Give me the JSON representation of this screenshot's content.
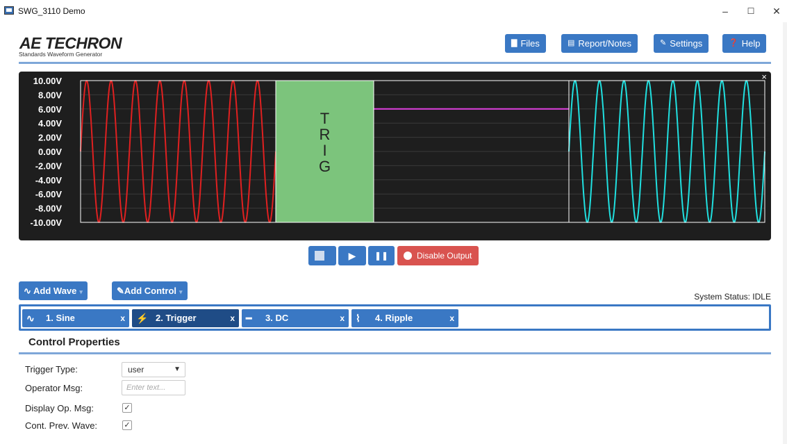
{
  "window": {
    "title": "SWG_3110 Demo",
    "minimize": "–",
    "maximize": "☐",
    "close": "✕"
  },
  "header": {
    "logo": "AE TECHRON",
    "subtitle": "Standards Waveform Generator",
    "buttons": [
      {
        "label": "Files",
        "icon": "folder-icon",
        "glyph": "▇"
      },
      {
        "label": "Report/Notes",
        "icon": "clipboard-icon",
        "glyph": "▤"
      },
      {
        "label": "Settings",
        "icon": "wrench-icon",
        "glyph": "✎"
      },
      {
        "label": "Help",
        "icon": "question-icon",
        "glyph": "❓"
      }
    ]
  },
  "scope": {
    "y_labels": [
      "10.00V",
      "8.00V",
      "6.00V",
      "4.00V",
      "2.00V",
      "0.00V",
      "-2.00V",
      "-4.00V",
      "-6.00V",
      "-8.00V",
      "-10.00V"
    ],
    "trigger_text": [
      "T",
      "R",
      "I",
      "G"
    ],
    "close": "×",
    "segments": [
      {
        "name": "1. Sine",
        "type": "sine",
        "color": "#e02020",
        "cycles": 8,
        "amplitude": 10
      },
      {
        "name": "2. Trigger",
        "type": "trigger",
        "color": "#7cc47c"
      },
      {
        "name": "3. DC",
        "type": "dc",
        "color": "#e040e0",
        "level": 6
      },
      {
        "name": "4. Ripple",
        "type": "sine",
        "color": "#20e0e0",
        "cycles": 8,
        "amplitude": 10
      }
    ]
  },
  "controls": {
    "stop": "",
    "play": "▶",
    "pause": "❚❚",
    "disable_output": "Disable Output"
  },
  "toolbar": {
    "add_wave": "Add Wave",
    "add_control": "Add Control",
    "caret": "▾",
    "system_status": "System Status: IDLE"
  },
  "tabs": [
    {
      "label": "1. Sine",
      "icon": "sine-icon",
      "glyph": "∿",
      "close": "x",
      "active": false
    },
    {
      "label": "2. Trigger",
      "icon": "trigger-icon",
      "glyph": "⚡",
      "close": "x",
      "active": true
    },
    {
      "label": "3. DC",
      "icon": "dc-icon",
      "glyph": "━",
      "close": "x",
      "active": false
    },
    {
      "label": "4. Ripple",
      "icon": "ripple-icon",
      "glyph": "⌇",
      "close": "x",
      "active": false
    }
  ],
  "properties": {
    "title": "Control Properties",
    "trigger_type_label": "Trigger Type:",
    "trigger_type_value": "user",
    "operator_msg_label": "Operator Msg:",
    "operator_msg_placeholder": "Enter text...",
    "display_op_msg_label": "Display Op. Msg:",
    "cont_prev_wave_label": "Cont. Prev. Wave:",
    "check": "✓"
  }
}
